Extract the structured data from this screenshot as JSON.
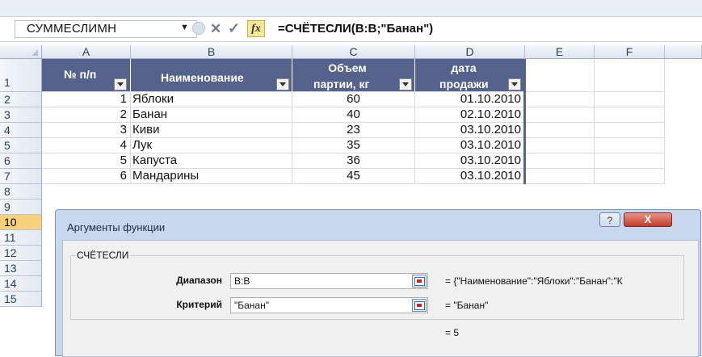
{
  "formula_bar": {
    "name_box": "СУММЕСЛИМН",
    "fx_label": "fx",
    "formula": "=СЧЁТЕСЛИ(B:B;\"Банан\")"
  },
  "columns": [
    "A",
    "B",
    "C",
    "D",
    "E",
    "F"
  ],
  "rows": [
    "1",
    "2",
    "3",
    "4",
    "5",
    "6",
    "7",
    "8",
    "9",
    "10",
    "11",
    "12",
    "13",
    "14",
    "15"
  ],
  "selected_row": "10",
  "table": {
    "headers": {
      "a": "№ п/п",
      "b": "Наименование",
      "c1": "Объем",
      "c2": "партии, кг",
      "d1": "дата",
      "d2": "продажи"
    },
    "rows": [
      {
        "n": "1",
        "name": "Яблоки",
        "qty": "60",
        "date": "01.10.2010"
      },
      {
        "n": "2",
        "name": "Банан",
        "qty": "40",
        "date": "02.10.2010"
      },
      {
        "n": "3",
        "name": "Киви",
        "qty": "23",
        "date": "03.10.2010"
      },
      {
        "n": "4",
        "name": "Лук",
        "qty": "35",
        "date": "03.10.2010"
      },
      {
        "n": "5",
        "name": "Капуста",
        "qty": "36",
        "date": "03.10.2010"
      },
      {
        "n": "6",
        "name": "Мандарины",
        "qty": "45",
        "date": "03.10.2010"
      }
    ]
  },
  "dialog": {
    "title": "Аргументы функции",
    "help": "?",
    "close": "X",
    "function_name": "СЧЁТЕСЛИ",
    "args": [
      {
        "label": "Диапазон",
        "value": "B:B",
        "result": "=  {\"Наименование\":\"Яблоки\":\"Банан\":\"К"
      },
      {
        "label": "Критерий",
        "value": "\"Банан\"",
        "result": "=  \"Банан\""
      }
    ],
    "total": "=  5"
  }
}
